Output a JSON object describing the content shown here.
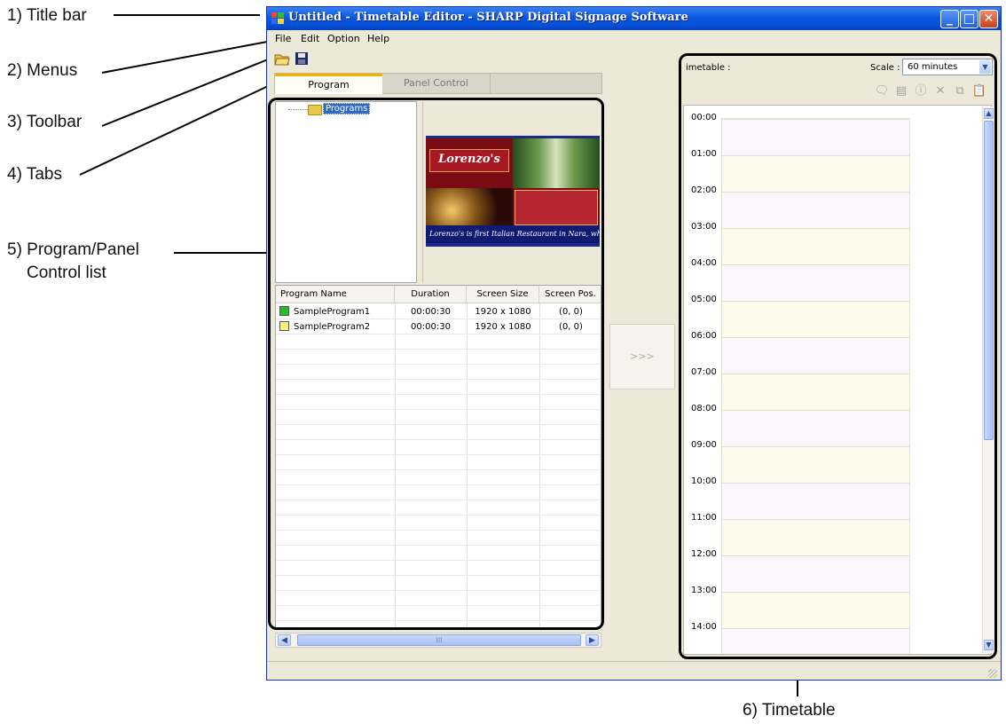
{
  "window": {
    "title": "Untitled - Timetable Editor - SHARP Digital Signage Software",
    "minimize_glyph": "_",
    "maximize_glyph": "□",
    "close_glyph": "✕"
  },
  "menu": [
    "File",
    "Edit",
    "Option",
    "Help"
  ],
  "toolbar": {
    "icons": [
      "open-folder-icon",
      "save-icon"
    ]
  },
  "tabs": [
    {
      "label": "Program",
      "active": true
    },
    {
      "label": "Panel Control",
      "active": false
    }
  ],
  "tree": {
    "root_label": "Programs"
  },
  "preview": {
    "heading": "Lorenzo's",
    "tagline": "Lorenzo's is first Italian Restaurant in Nara, whi"
  },
  "program_list": {
    "columns": [
      "Program Name",
      "Duration",
      "Screen Size",
      "Screen Pos."
    ],
    "rows": [
      {
        "name": "SampleProgram1",
        "duration": "00:00:30",
        "size": "1920 x 1080",
        "pos": "(0, 0)",
        "color": "#22c022"
      },
      {
        "name": "SampleProgram2",
        "duration": "00:00:30",
        "size": "1920 x 1080",
        "pos": "(0, 0)",
        "color": "#f6ef7e"
      }
    ],
    "scroll_glyph": "III"
  },
  "move_button": ">>>",
  "timetable": {
    "label": "imetable :",
    "scale_label": "Scale :",
    "scale_value": "60 minutes",
    "hours": [
      "00:00",
      "01:00",
      "02:00",
      "03:00",
      "04:00",
      "05:00",
      "06:00",
      "07:00",
      "08:00",
      "09:00",
      "10:00",
      "11:00",
      "12:00",
      "13:00",
      "14:00"
    ],
    "action_icons": [
      "comment-icon",
      "panel-icon",
      "info-icon",
      "delete-icon",
      "copy-icon",
      "paste-icon"
    ]
  },
  "annotations": {
    "title_bar": "1) Title bar",
    "menus": "2) Menus",
    "toolbar": "3) Toolbar",
    "tabs": "4) Tabs",
    "program_panel_line1": "5) Program/Panel",
    "program_panel_line2": "Control list",
    "timetable": "6) Timetable"
  }
}
